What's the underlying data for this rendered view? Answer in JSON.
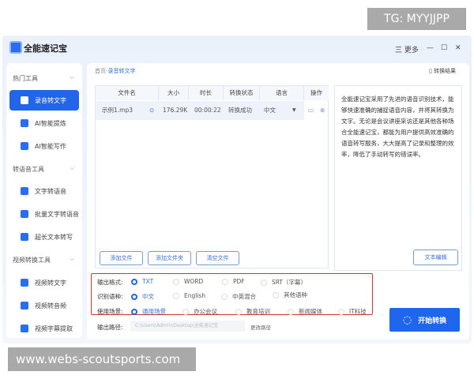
{
  "app": {
    "title": "全能速记宝",
    "more": "三 更多",
    "minimize": "—",
    "maximize": "☐",
    "close": "✕"
  },
  "sidebar": {
    "groups": [
      {
        "label": "热门工具",
        "items": [
          "录音转文字",
          "AI智能提炼",
          "AI智能写作"
        ]
      },
      {
        "label": "转语音工具",
        "items": [
          "文字转语音",
          "批量文字转语音",
          "超长文本转写"
        ]
      },
      {
        "label": "视频转换工具",
        "items": [
          "视频转文字",
          "视频转音频",
          "视频字幕提取"
        ]
      }
    ],
    "active": "录音转文字"
  },
  "breadcrumb": {
    "home": "首页",
    "sep": "-",
    "current": "录音转文字"
  },
  "result_link": "转换结果",
  "table": {
    "headers": [
      "文件名",
      "大小",
      "时长",
      "转换状态",
      "语言",
      "操作"
    ],
    "rows": [
      {
        "name": "示例1.mp3",
        "size": "176.29K",
        "duration": "00:00:22",
        "status": "转换成功",
        "language": "中文"
      }
    ]
  },
  "description": "全能速记宝采用了先进的语音识别技术，能够快速准确的捕捉语音内容，并将其转换为文字。无论是会议讲座采访还是其他各种场合全能速记宝，都能为用户提供高效准确的语音转写服务，大大提高了记录和整理的效率，降低了手动转写的错误率。",
  "buttons": {
    "add_file": "添加文件",
    "add_folder": "添加文件夹",
    "clear": "清空文件",
    "edit_text": "文本编辑",
    "start": "开始转换",
    "change_path": "更改路径"
  },
  "options": {
    "format": {
      "label": "输出格式:",
      "choices": [
        "TXT",
        "WORD",
        "PDF",
        "SRT（字幕）"
      ],
      "selected": "TXT"
    },
    "lang": {
      "label": "识别语种:",
      "choices": [
        "中文",
        "English",
        "中英混合",
        "其他语种"
      ],
      "selected": "中文"
    },
    "scene": {
      "label": "使用场景:",
      "choices": [
        "通用场景",
        "办公会议",
        "教育培训",
        "新闻媒体",
        "IT科技"
      ],
      "selected": "通用场景"
    }
  },
  "output_path": {
    "label": "输出路径:",
    "value": "C:\\Users\\Admin\\Desktop\\全能速记宝"
  },
  "watermarks": {
    "top": "TG: MYYJJPP",
    "bottom": "www.webs-scoutsports.com"
  },
  "colors": {
    "accent": "#2265e8",
    "highlight_box": "#c83a3a"
  }
}
